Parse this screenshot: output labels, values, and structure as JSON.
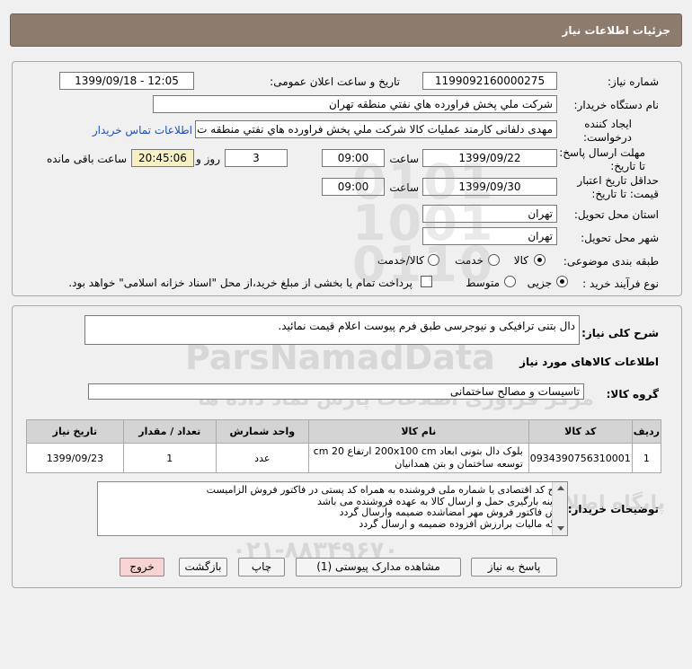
{
  "page_title": "جزئیات اطلاعات نیاز",
  "fields": {
    "need_number_label": "شماره نیاز:",
    "need_number": "1199092160000275",
    "announce_label": "تاریخ و ساعت اعلان عمومی:",
    "announce_value": "1399/09/18 - 12:05",
    "buyer_org_label": "نام دستگاه خریدار:",
    "buyer_org": "شرکت ملي پخش فراورده هاي نفتي منطقه تهران",
    "creator_label_1": "ایجاد کننده",
    "creator_label_2": "درخواست:",
    "creator": "مهدی دلفانی کارمند عملیات کالا شرکت ملي پخش فراورده هاي نفتي منطقه ت",
    "contact_link": "اطلاعات تماس خریدار",
    "reply_deadline_label_1": "مهلت ارسال پاسخ:",
    "reply_deadline_label_2": "تا تاریخ:",
    "reply_date": "1399/09/22",
    "time_label": "ساعت",
    "reply_time": "09:00",
    "days_value": "3",
    "days_label": "روز و",
    "remaining_time": "20:45:06",
    "remaining_label": "ساعت باقی مانده",
    "price_validity_label_1": "حداقل تاریخ اعتبار",
    "price_validity_label_2": "قیمت: تا تاریخ:",
    "validity_date": "1399/09/30",
    "validity_time": "09:00",
    "province_label": "استان محل تحویل:",
    "province": "تهران",
    "city_label": "شهر محل تحویل:",
    "city": "تهران",
    "category_label": "طبقه بندی موضوعی:",
    "category_options": [
      "کالا",
      "خدمت",
      "کالا/خدمت"
    ],
    "process_label": "نوع فرآیند خرید :",
    "process_options": [
      "جزیی",
      "متوسط"
    ],
    "payment_note": "پرداخت تمام یا بخشی از مبلغ خرید،از محل \"اسناد خزانه اسلامی\" خواهد بود."
  },
  "summary": {
    "label": "شرح کلی نیاز:",
    "value": "دال بتنی ترافیکی و نیوجرسی طبق فرم پیوست اعلام قیمت نمائید."
  },
  "goods_section_title": "اطلاعات کالاهای مورد نیاز",
  "goods_group": {
    "label": "گروه کالا:",
    "value": "تاسیسات و مصالح ساختمانی"
  },
  "table": {
    "headers": [
      "ردیف",
      "کد کالا",
      "نام کالا",
      "واحد شمارش",
      "تعداد / مقدار",
      "تاریخ نیاز"
    ],
    "rows": [
      {
        "row": "1",
        "code": "0934390756310001",
        "name": "بلوک دال بتونی ابعاد 200x100 cm ارتفاع 20 cm توسعه ساختمان و بتن همدانیان",
        "unit": "عدد",
        "qty": "1",
        "date": "1399/09/23"
      }
    ]
  },
  "buyer_notes": {
    "label": "توضیحات خریدار:",
    "lines": [
      "درج کد اقتصادی یا شماره ملی فروشنده به همراه کد پستی در فاکتور فروش الزامیست",
      "هزینه بارگیری حمل و ارسال کالا به عهده فروشنده می باشد",
      "پیش فاکتور فروش مهر امضاشده ضمیمه وارسال گردد",
      "برگه مالیات برارزش افزوده ضمیمه و ارسال گردد"
    ]
  },
  "buttons": {
    "reply": "پاسخ به نیاز",
    "attachments": "مشاهده مدارک پیوستی (1)",
    "print": "چاپ",
    "back": "بازگشت",
    "exit": "خروج"
  },
  "watermark": {
    "brand": "ParsNamadData",
    "line1": "مرکز فراوری اطلاعات پارس نماد داده ها",
    "line2": "پایگاه اطلاع رسانی مناقصات و مزایده",
    "phone": "۰۲۱-۸۸۳۴۹۶۷۰"
  },
  "colors": {
    "titlebar": "#8d7b6e",
    "link": "#1f4fb4",
    "remaining_bg": "#f6f0c4",
    "exit_button_bg": "#f8d3d3"
  }
}
